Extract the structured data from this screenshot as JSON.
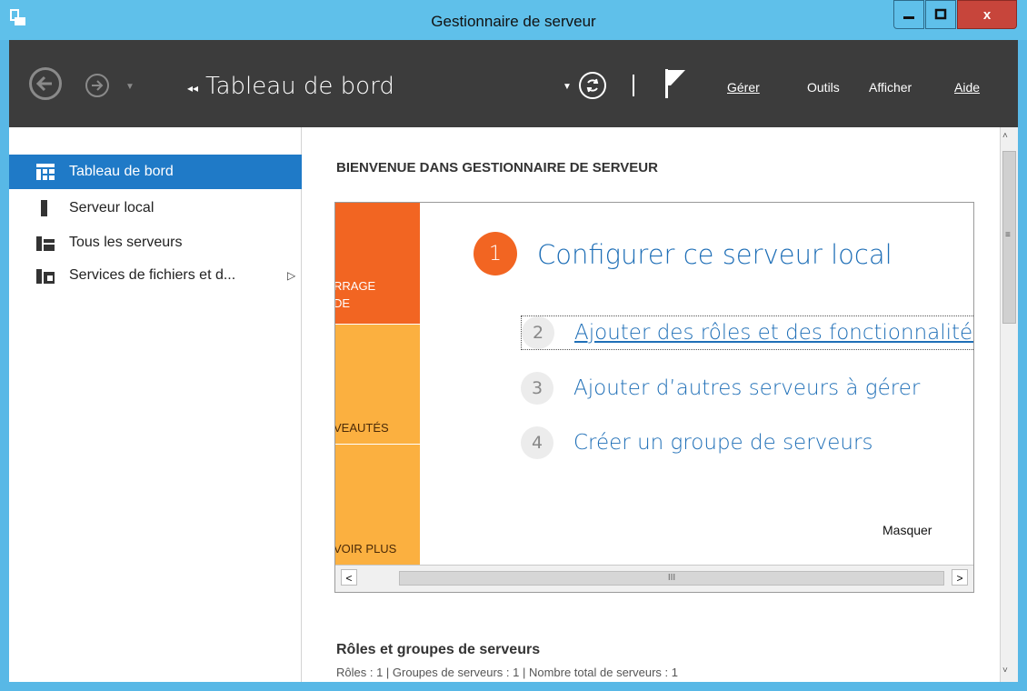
{
  "window": {
    "title": "Gestionnaire de serveur",
    "minimize_label": "▁",
    "maximize_label": "□",
    "close_label": "x"
  },
  "toolbar": {
    "breadcrumb_arrows": "◂◂",
    "breadcrumb": "Tableau de bord",
    "menus": [
      "Gérer",
      "Outils",
      "Afficher",
      "Aide"
    ]
  },
  "sidebar": {
    "items": [
      {
        "label": "Tableau de bord",
        "icon": "dashboard-icon",
        "active": true
      },
      {
        "label": "Serveur local",
        "icon": "server-icon"
      },
      {
        "label": "Tous les serveurs",
        "icon": "servers-icon"
      },
      {
        "label": "Services de fichiers et d...",
        "icon": "file-services-icon",
        "expand": "▷"
      }
    ]
  },
  "welcome": {
    "heading": "BIENVENUE DANS GESTIONNAIRE DE SERVEUR",
    "tiles": [
      "RRAGE\nDE",
      "VEAUTÉS",
      "VOIR PLUS"
    ],
    "steps": [
      {
        "num": "1",
        "label": "Configurer ce serveur local"
      },
      {
        "num": "2",
        "label": "Ajouter des rôles et des fonctionnalités"
      },
      {
        "num": "3",
        "label": "Ajouter d’autres serveurs à gérer"
      },
      {
        "num": "4",
        "label": "Créer un groupe de serveurs"
      }
    ],
    "hide": "Masquer",
    "hscroll_left": "<",
    "hscroll_right": ">",
    "hscroll_grip": "III"
  },
  "roles": {
    "heading": "Rôles et groupes de serveurs",
    "summary": "Rôles : 1  |  Groupes de serveurs : 1  |  Nombre total de serveurs : 1"
  },
  "scrollbar": {
    "up": "˄",
    "down": "˅",
    "grip": "≡"
  },
  "colors": {
    "accent": "#1f7ac7",
    "orange": "#f26522",
    "yellow": "#fbb040",
    "toolbar": "#3c3c3c"
  }
}
